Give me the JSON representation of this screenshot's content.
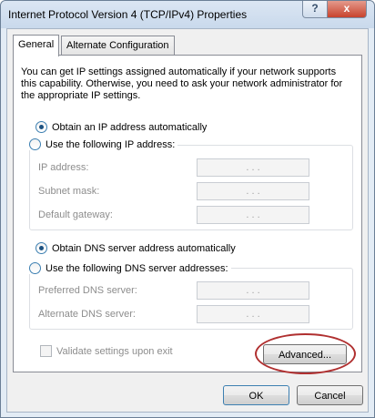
{
  "window": {
    "title": "Internet Protocol Version 4 (TCP/IPv4) Properties",
    "help_glyph": "?",
    "close_glyph": "x"
  },
  "tabs": [
    {
      "label": "General",
      "selected": true
    },
    {
      "label": "Alternate Configuration",
      "selected": false
    }
  ],
  "general": {
    "description": "You can get IP settings assigned automatically if your network supports this capability. Otherwise, you need to ask your network administrator for the appropriate IP settings.",
    "ip_auto_label": "Obtain an IP address automatically",
    "ip_manual_label": "Use the following IP address:",
    "ip_fields": [
      {
        "label": "IP address:",
        "value": ".     .     ."
      },
      {
        "label": "Subnet mask:",
        "value": ".     .     ."
      },
      {
        "label": "Default gateway:",
        "value": ".     .     ."
      }
    ],
    "dns_auto_label": "Obtain DNS server address automatically",
    "dns_manual_label": "Use the following DNS server addresses:",
    "dns_fields": [
      {
        "label": "Preferred DNS server:",
        "value": ".     .     ."
      },
      {
        "label": "Alternate DNS server:",
        "value": ".     .     ."
      }
    ],
    "validate_label": "Validate settings upon exit",
    "advanced_label": "Advanced..."
  },
  "footer": {
    "ok_label": "OK",
    "cancel_label": "Cancel"
  },
  "colors": {
    "highlight_ring": "#b03030"
  }
}
